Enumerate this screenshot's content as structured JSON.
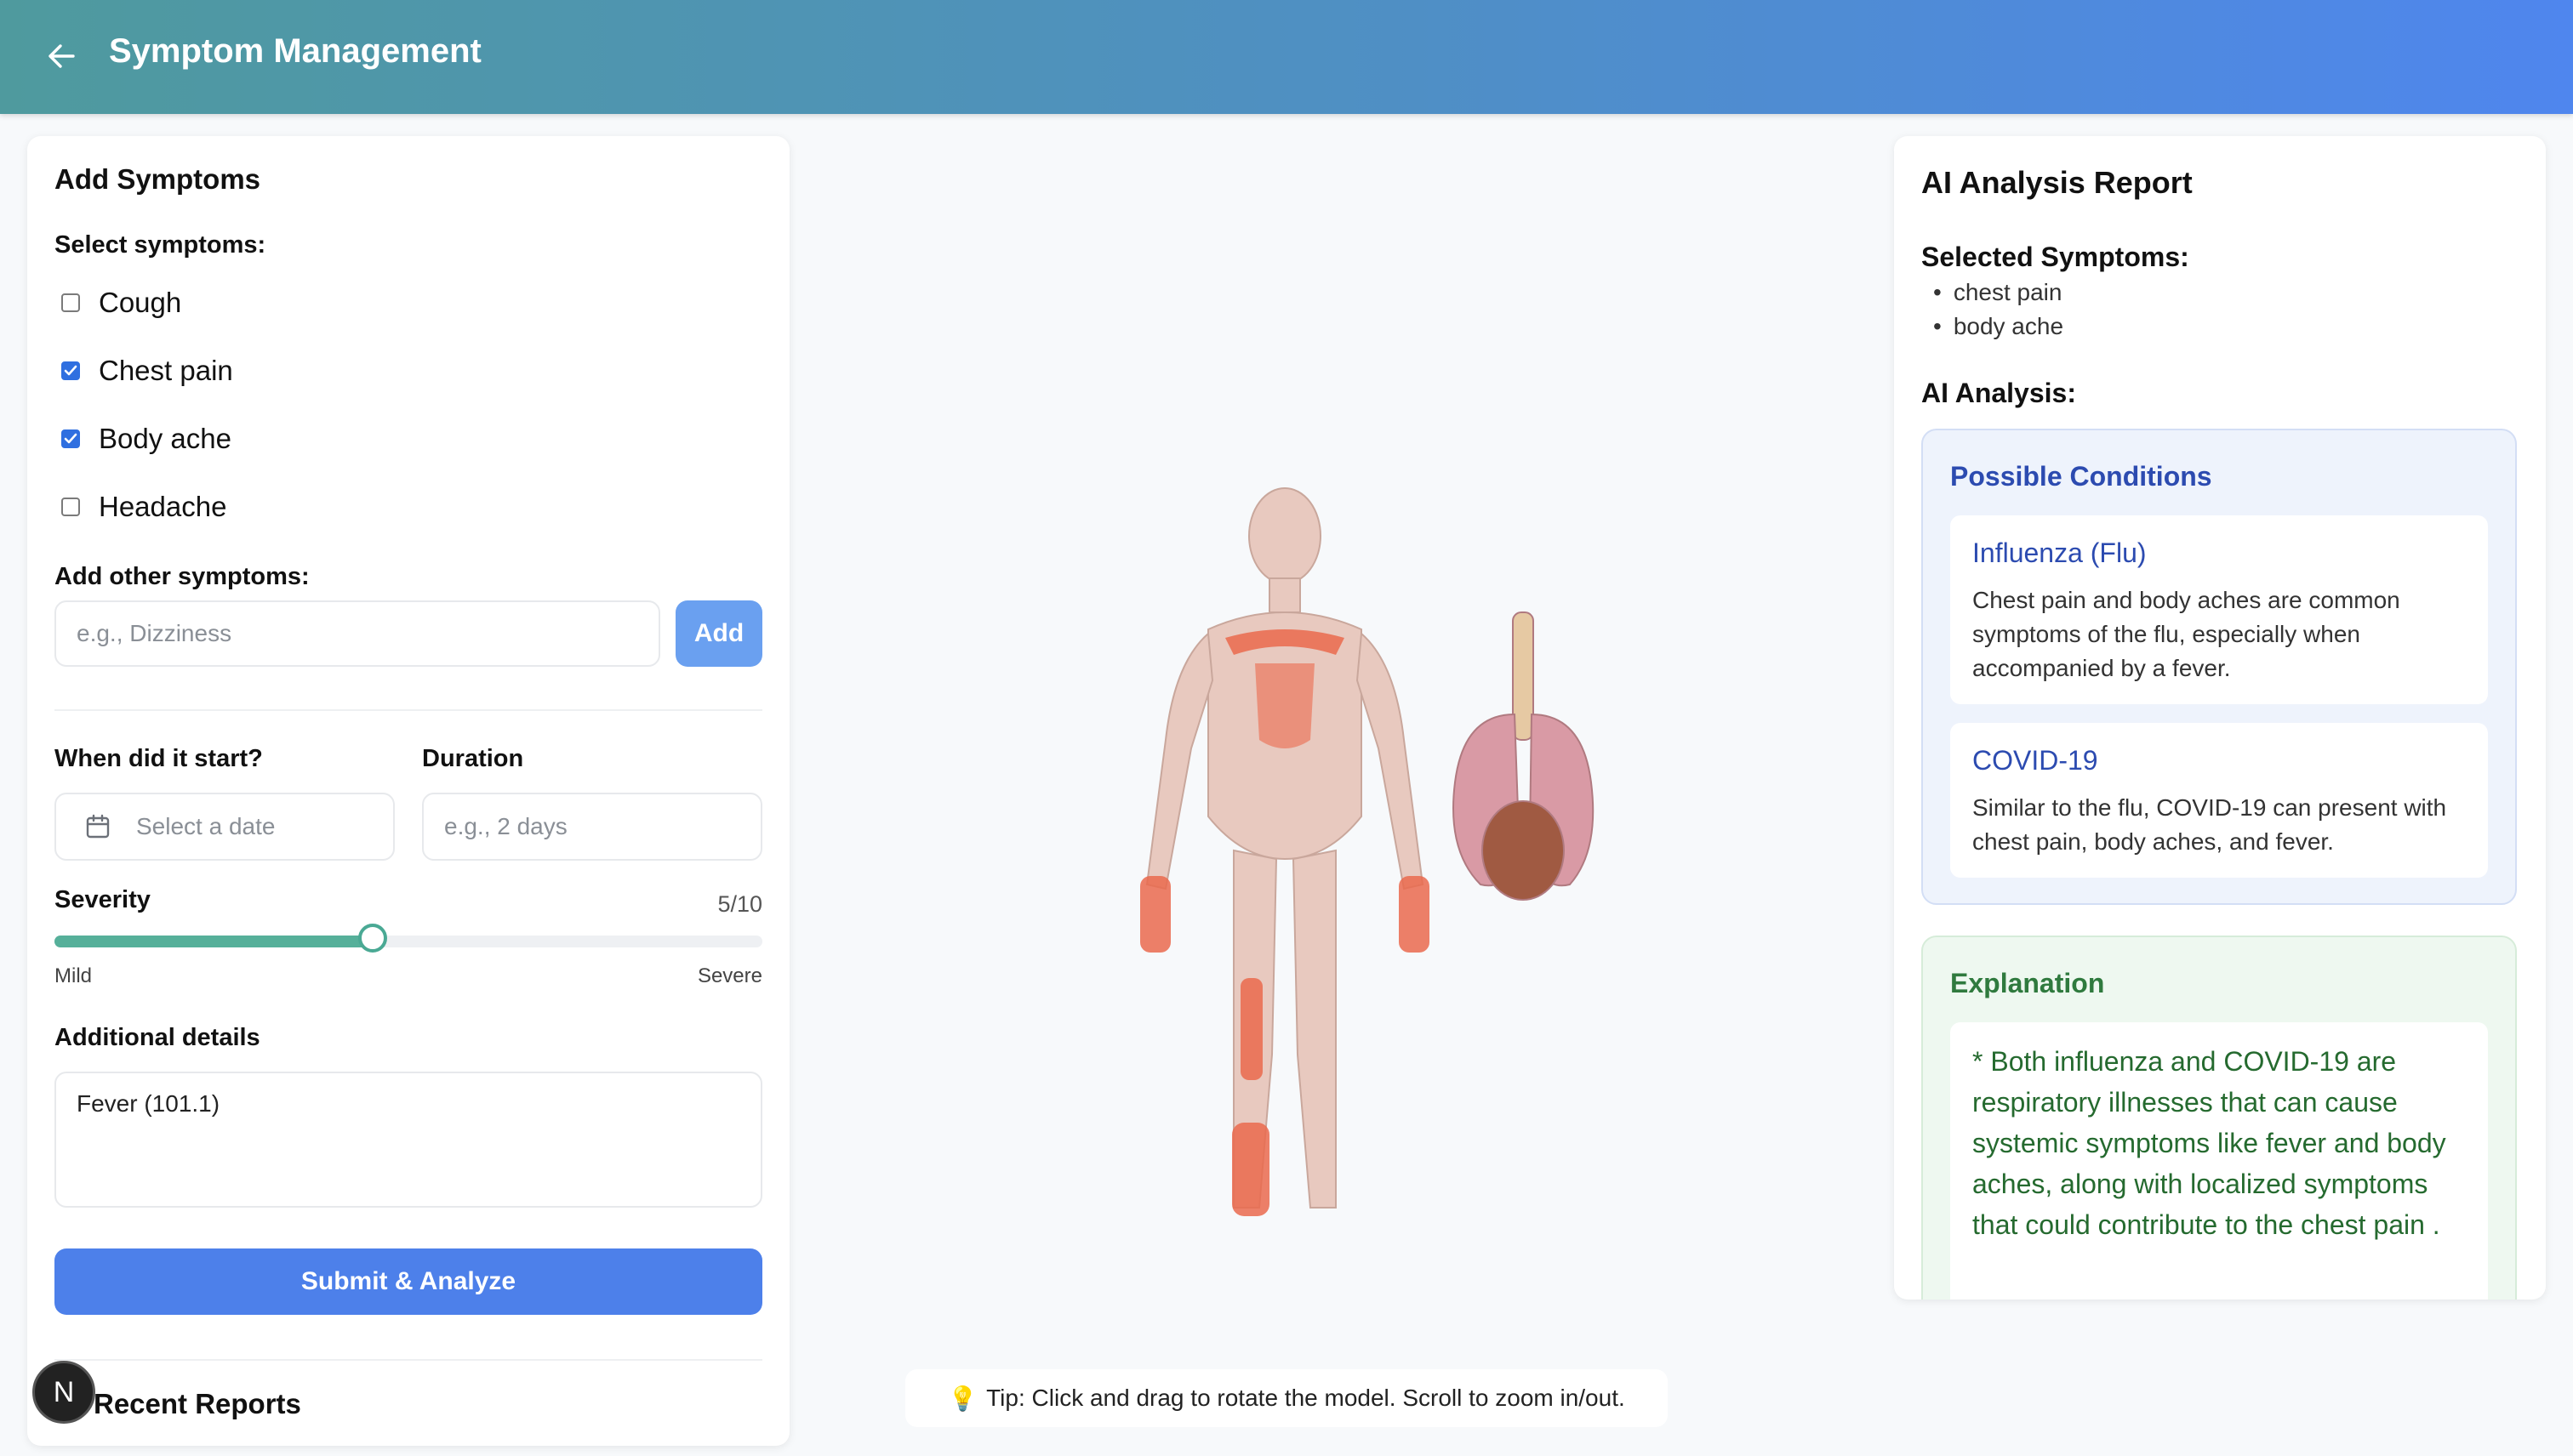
{
  "header": {
    "title": "Symptom Management",
    "back_icon": "arrow-left-icon"
  },
  "symptoms_form": {
    "title": "Add Symptoms",
    "select_label": "Select symptoms:",
    "options": [
      {
        "label": "Cough",
        "checked": false
      },
      {
        "label": "Chest pain",
        "checked": true
      },
      {
        "label": "Body ache",
        "checked": true
      },
      {
        "label": "Headache",
        "checked": false
      }
    ],
    "other_label": "Add other symptoms:",
    "other_placeholder": "e.g., Dizziness",
    "add_label": "Add",
    "start_label": "When did it start?",
    "start_placeholder": "Select a date",
    "duration_label": "Duration",
    "duration_placeholder": "e.g., 2 days",
    "severity_label": "Severity",
    "severity_value": "5/10",
    "severity_fraction": 0.45,
    "severity_min_label": "Mild",
    "severity_max_label": "Severe",
    "details_label": "Additional details",
    "details_value": "Fever (101.1)",
    "submit_label": "Submit & Analyze",
    "recent_title": "Recent Reports"
  },
  "badge": {
    "letter": "N"
  },
  "tip": {
    "text": "Tip: Click and drag to rotate the model. Scroll to zoom in/out."
  },
  "report": {
    "title": "AI Analysis Report",
    "selected_heading": "Selected Symptoms:",
    "selected": [
      "chest pain",
      "body ache"
    ],
    "analysis_heading": "AI Analysis:",
    "conditions_heading": "Possible Conditions",
    "conditions": [
      {
        "name": "Influenza (Flu)",
        "description": "Chest pain and body aches are common symptoms of the flu, especially when accompanied by a fever."
      },
      {
        "name": "COVID-19",
        "description": "Similar to the flu, COVID-19 can present with chest pain, body aches, and fever."
      }
    ],
    "explanation_heading": "Explanation",
    "explanation": "* Both influenza and COVID-19 are respiratory illnesses that can cause systemic symptoms like fever and body aches, along with localized symptoms that could contribute to the chest pain ."
  },
  "colors": {
    "accent": "#4d80ea",
    "teal": "#56b09a",
    "condition_title": "#2c4bb0",
    "explanation_text": "#256a2f"
  }
}
